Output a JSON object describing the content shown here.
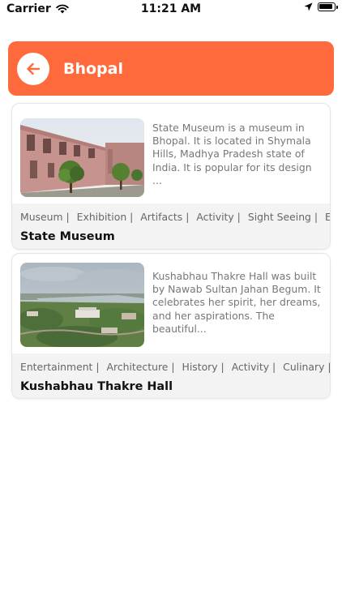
{
  "status_bar": {
    "carrier": "Carrier",
    "time": "11:21 AM"
  },
  "header": {
    "title": "Bhopal",
    "accent": "#ff6a3d"
  },
  "places": [
    {
      "title": "State Museum",
      "description": "State Museum is a museum in Bhopal. It is located in Shymala Hills, Madhya Pradesh state of India. It is popular for its design ...",
      "tags": [
        "Museum |",
        "Exhibition |",
        "Artifacts |",
        "Activity |",
        "Sight Seeing |",
        "En"
      ]
    },
    {
      "title": "Kushabhau Thakre Hall",
      "description": "Kushabhau Thakre Hall was built by Nawab Sultan Jahan Begum. It celebrates her spirit, her dreams, and her aspirations. The beautiful...",
      "tags": [
        "Entertainment |",
        "Architecture |",
        "History |",
        "Activity |",
        "Culinary |"
      ]
    }
  ]
}
